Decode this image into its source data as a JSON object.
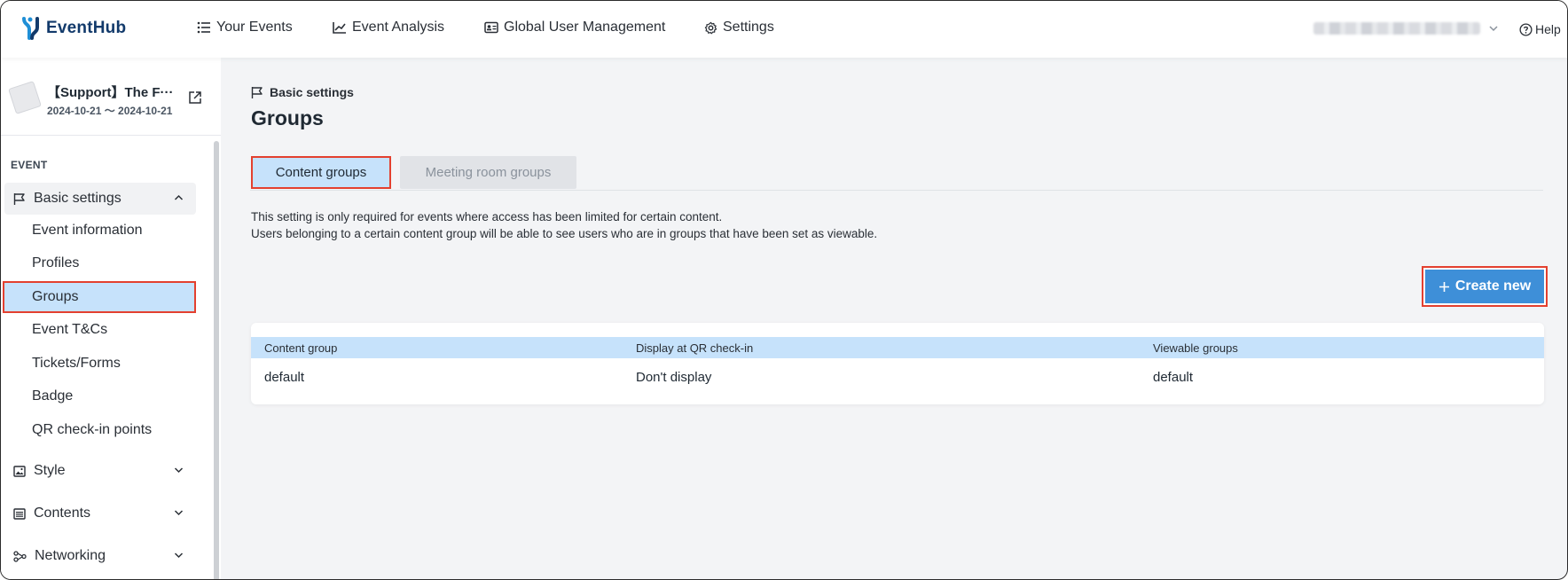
{
  "app": {
    "logo_text": "EventHub",
    "accent_color": "#3e8fd8",
    "highlight_color": "#c6e2fb",
    "annotation_color": "#e3402f"
  },
  "topnav": {
    "items": [
      {
        "label": "Your Events",
        "icon": "list-icon"
      },
      {
        "label": "Event Analysis",
        "icon": "chart-icon"
      },
      {
        "label": "Global User Management",
        "icon": "id-card-icon"
      },
      {
        "label": "Settings",
        "icon": "gear-icon"
      }
    ],
    "help_label": "Help"
  },
  "sidebar": {
    "event": {
      "name": "【Support】The F···",
      "dates": "2024-10-21 ～ 2024-10-21"
    },
    "section_label": "EVENT",
    "groups": [
      {
        "label": "Basic settings",
        "icon": "flag-icon",
        "expanded": true,
        "items": [
          {
            "label": "Event information"
          },
          {
            "label": "Profiles"
          },
          {
            "label": "Groups",
            "selected": true
          },
          {
            "label": "Event T&Cs"
          },
          {
            "label": "Tickets/Forms"
          },
          {
            "label": "Badge"
          },
          {
            "label": "QR check-in points"
          }
        ]
      },
      {
        "label": "Style",
        "icon": "image-icon",
        "expanded": false
      },
      {
        "label": "Contents",
        "icon": "list-box-icon",
        "expanded": false
      },
      {
        "label": "Networking",
        "icon": "network-icon",
        "expanded": false
      }
    ]
  },
  "main": {
    "breadcrumb": "Basic settings",
    "title": "Groups",
    "tabs": [
      {
        "label": "Content groups",
        "active": true
      },
      {
        "label": "Meeting room groups",
        "active": false
      }
    ],
    "description_lines": [
      "This setting is only required for events where access has been limited for certain content.",
      "Users belonging to a certain content group will be able to see users who are in groups that have been set as viewable."
    ],
    "create_button": "Create new",
    "table": {
      "columns": [
        "Content group",
        "Display at QR check-in",
        "Viewable groups"
      ],
      "rows": [
        [
          "default",
          "Don't display",
          "default"
        ]
      ]
    }
  }
}
